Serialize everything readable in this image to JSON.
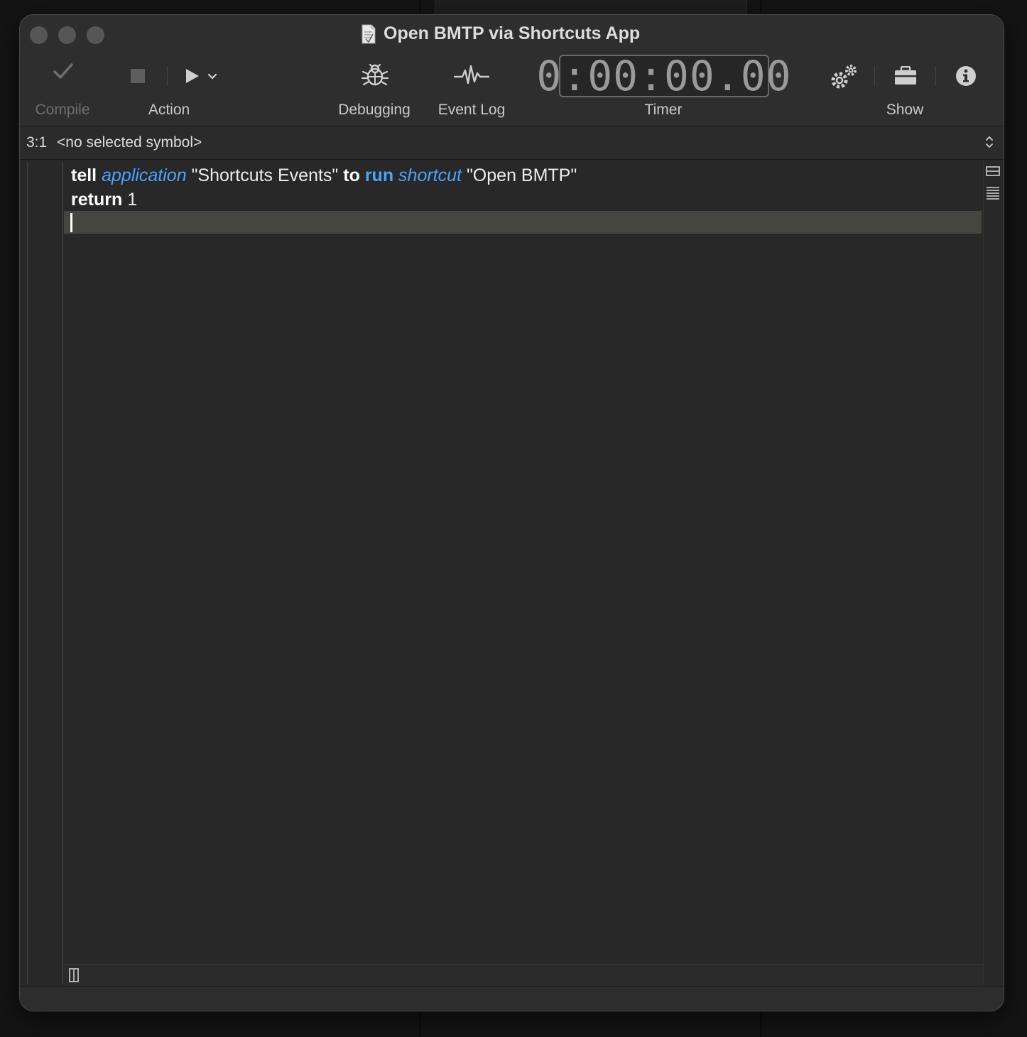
{
  "window": {
    "title": "Open BMTP via Shortcuts App"
  },
  "toolbar": {
    "compile_label": "Compile",
    "action_label": "Action",
    "debugging_label": "Debugging",
    "event_log_label": "Event Log",
    "timer_label": "Timer",
    "timer_value": "0:00:00.00",
    "show_label": "Show"
  },
  "navigation": {
    "position": "3:1",
    "symbol": "<no selected symbol>"
  },
  "editor": {
    "line1": {
      "t1": "tell",
      "t2": "application",
      "t3": "\"Shortcuts Events\"",
      "t4": "to",
      "t5": "run",
      "t6": "shortcut",
      "t7": "\"Open BMTP\""
    },
    "line2": {
      "t1": "return",
      "t2": "1"
    }
  },
  "colors": {
    "keyword": "#ffffff",
    "application_term": "#4aa3ff",
    "current_line": "#464640"
  }
}
